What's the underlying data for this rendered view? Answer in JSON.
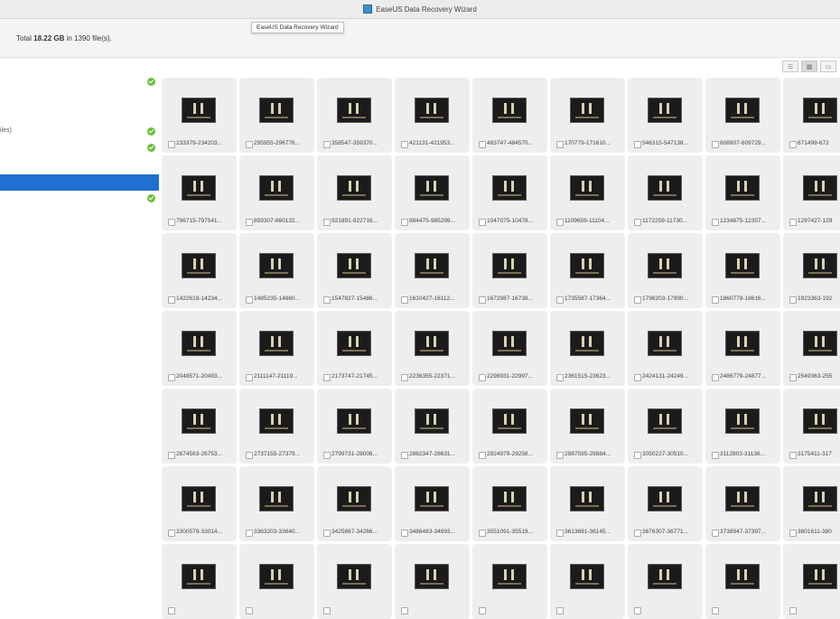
{
  "window": {
    "title": "EaseUS Data Recovery Wizard",
    "tooltip": "EaseUS Data Recovery Wizard"
  },
  "summary": {
    "prefix": "Total ",
    "size": "18.22 GB",
    "middle": " in ",
    "count": "1390",
    "suffix": " file(s)."
  },
  "view_modes": [
    "list-view-icon",
    "thumbnail-view-icon",
    "preview-view-icon"
  ],
  "sidebar": {
    "items": [
      {
        "label": "",
        "checked": true,
        "selected": false
      },
      {
        "label": "iles)",
        "checked": true,
        "selected": false
      },
      {
        "label": "",
        "checked": true,
        "selected": false
      },
      {
        "label": "",
        "checked": false,
        "selected": true
      },
      {
        "label": "",
        "checked": true,
        "selected": false
      }
    ],
    "selected_color": "#1f6fd0"
  },
  "files": [
    "233379-234203...",
    "295955-296776...",
    "358547-359370...",
    "421131-421953...",
    "483747-484570...",
    "170779-171610...",
    "546315-547138...",
    "608907-609729...",
    "671499-672",
    "796715-797541...",
    "859307-860132...",
    "921891-922716...",
    "984475-985299...",
    "1047075-10478...",
    "1109659-11104...",
    "1172259-11730...",
    "1234875-12357...",
    "1297427-129",
    "1422619-14234...",
    "1485235-14860...",
    "1547827-15486...",
    "1610427-16112...",
    "1672987-16738...",
    "1735587-17364...",
    "1798203-17990...",
    "1860779-18616...",
    "1923363-192",
    "2048571-20493...",
    "2111147-21119...",
    "2173747-21745...",
    "2236355-22371...",
    "2298931-22997...",
    "2361515-23623...",
    "2424131-24249...",
    "2486779-24877...",
    "2549363-255",
    "2674563-26753...",
    "2737155-27379...",
    "2799731-28006...",
    "2862347-28631...",
    "2924979-29258...",
    "2987595-29884...",
    "3050227-30510...",
    "3112803-31136...",
    "3175411-317",
    "3300579-33014...",
    "3363203-33640...",
    "3425867-34266...",
    "3488483-34893...",
    "3551091-35519...",
    "3613691-36145...",
    "3676307-36771...",
    "3738947-37397...",
    "3801611-380",
    "",
    "",
    "",
    "",
    "",
    "",
    "",
    "",
    ""
  ],
  "check_color": "#6cbf3d"
}
